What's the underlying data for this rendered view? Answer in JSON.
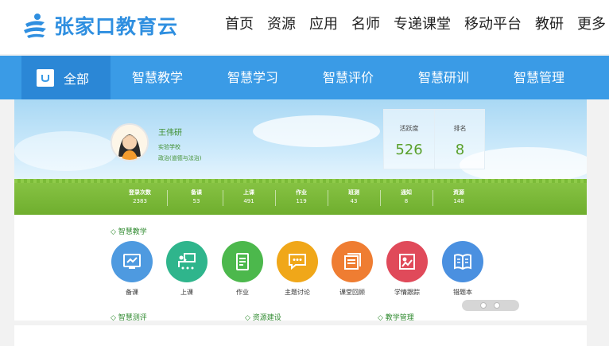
{
  "header": {
    "logo_text": "张家口教育云",
    "nav": [
      "首页",
      "资源",
      "应用",
      "名师",
      "专递课堂",
      "移动平台",
      "教研",
      "更多"
    ]
  },
  "category_nav": {
    "all_label": "全部",
    "items": [
      "智慧教学",
      "智慧学习",
      "智慧评价",
      "智慧研训",
      "智慧管理"
    ]
  },
  "profile": {
    "name": "王伟研",
    "school": "实验学校",
    "subject": "政治(道德与法治)",
    "activity_label": "活跃度",
    "activity_value": "526",
    "rank_label": "排名",
    "rank_value": "8"
  },
  "stats": [
    {
      "label": "登录次数",
      "value": "2383"
    },
    {
      "label": "备课",
      "value": "53"
    },
    {
      "label": "上课",
      "value": "491"
    },
    {
      "label": "作业",
      "value": "119"
    },
    {
      "label": "班测",
      "value": "43"
    },
    {
      "label": "通知",
      "value": "8"
    },
    {
      "label": "资源",
      "value": "148"
    }
  ],
  "sections": {
    "teaching": "◇ 智慧教学",
    "assessment": "◇ 智慧测评",
    "resources": "◇ 资源建设",
    "management": "◇ 教学管理"
  },
  "apps": [
    {
      "label": "备课",
      "color": "#4e9ae0",
      "icon": "lesson-prep-icon"
    },
    {
      "label": "上课",
      "color": "#2fb58c",
      "icon": "teaching-icon"
    },
    {
      "label": "作业",
      "color": "#4cb84c",
      "icon": "homework-icon"
    },
    {
      "label": "主题讨论",
      "color": "#f0a719",
      "icon": "discussion-icon"
    },
    {
      "label": "课堂回顾",
      "color": "#ef7d32",
      "icon": "review-icon"
    },
    {
      "label": "学情跟踪",
      "color": "#e04a5a",
      "icon": "tracking-icon"
    },
    {
      "label": "错题本",
      "color": "#4a90e0",
      "icon": "mistake-book-icon"
    }
  ]
}
